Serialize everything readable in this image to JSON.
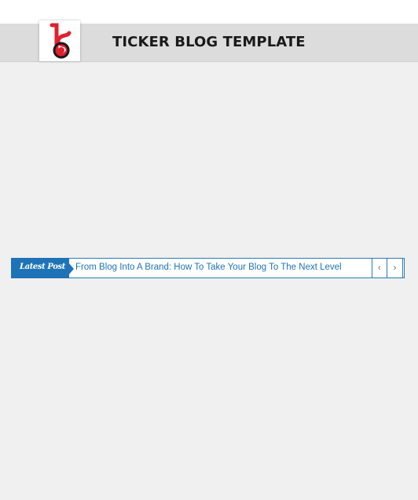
{
  "header": {
    "title": "TICKER BLOG TEMPLATE",
    "logo_icon": "bs-logo-icon",
    "logo_color": "#e0202e"
  },
  "ticker": {
    "label": "Latest Post",
    "items": [
      "From Blog Into A Brand: How To Take Your Blog To The Next Level"
    ],
    "prev_icon": "chevron-left-icon",
    "next_icon": "chevron-right-icon",
    "prev_glyph": "‹",
    "next_glyph": "›",
    "accent_color": "#1e73b7"
  }
}
